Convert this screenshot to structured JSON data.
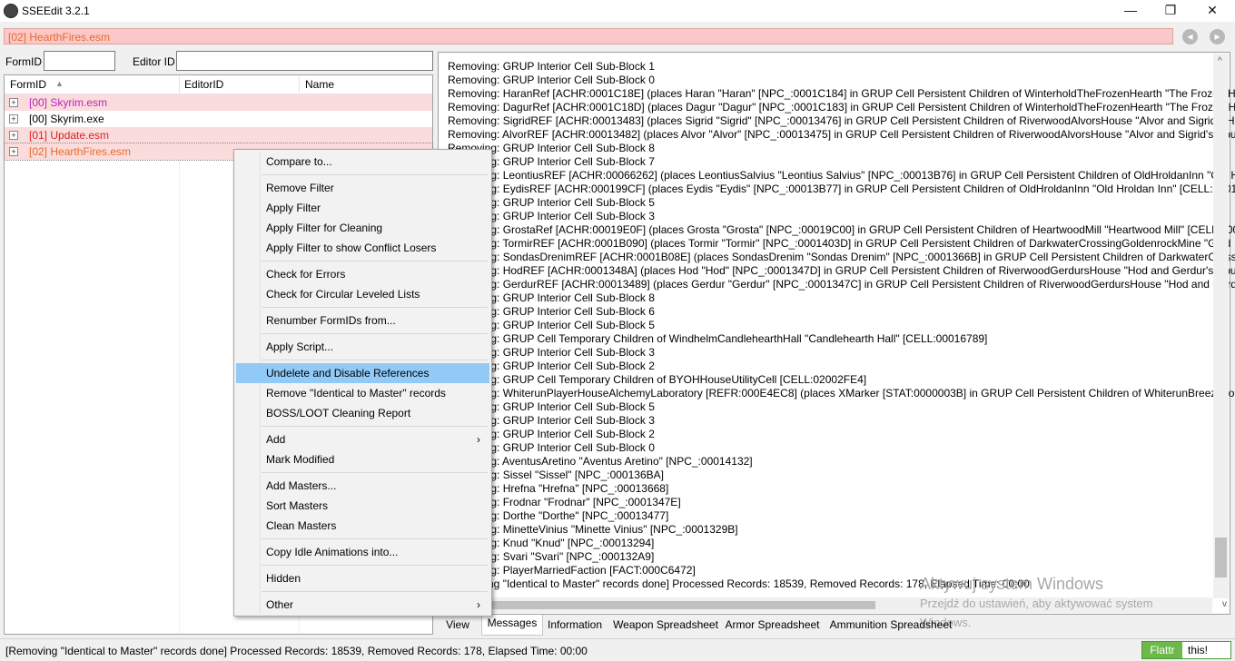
{
  "window": {
    "title": "SSEEdit 3.2.1",
    "minimize": "—",
    "maximize": "❐",
    "close": "✕"
  },
  "pathbar": {
    "text": "[02] HearthFires.esm",
    "back": "◂",
    "forward": "▸"
  },
  "filters": {
    "formid_label": "FormID",
    "editorid_label": "Editor ID",
    "formid_value": "",
    "editorid_value": ""
  },
  "tree": {
    "columns": [
      "FormID",
      "EditorID",
      "Name"
    ],
    "sort_arrow": "▲",
    "rows": [
      {
        "label": "[00] Skyrim.esm",
        "color": "#c020c0",
        "bg": "#fadcdc"
      },
      {
        "label": "[00] Skyrim.exe",
        "color": "#000000",
        "bg": "#ffffff"
      },
      {
        "label": "[01] Update.esm",
        "color": "#e02020",
        "bg": "#fadcdc"
      },
      {
        "label": "[02] HearthFires.esm",
        "color": "#e86a2a",
        "bg": "#fadcdc"
      }
    ]
  },
  "context_menu": {
    "items": [
      {
        "label": "Compare to...",
        "type": "item"
      },
      {
        "type": "sep"
      },
      {
        "label": "Remove Filter",
        "type": "item"
      },
      {
        "label": "Apply Filter",
        "type": "item"
      },
      {
        "label": "Apply Filter for Cleaning",
        "type": "item"
      },
      {
        "label": "Apply Filter to show Conflict Losers",
        "type": "item"
      },
      {
        "type": "sep"
      },
      {
        "label": "Check for Errors",
        "type": "item"
      },
      {
        "label": "Check for Circular Leveled Lists",
        "type": "item"
      },
      {
        "type": "sep"
      },
      {
        "label": "Renumber FormIDs from...",
        "type": "item"
      },
      {
        "type": "sep"
      },
      {
        "label": "Apply Script...",
        "type": "item"
      },
      {
        "type": "sep"
      },
      {
        "label": "Undelete and Disable References",
        "type": "item",
        "highlight": true
      },
      {
        "label": "Remove \"Identical to Master\" records",
        "type": "item"
      },
      {
        "label": "BOSS/LOOT Cleaning Report",
        "type": "item"
      },
      {
        "type": "sep"
      },
      {
        "label": "Add",
        "type": "item",
        "submenu": true
      },
      {
        "label": "Mark Modified",
        "type": "item"
      },
      {
        "type": "sep"
      },
      {
        "label": "Add Masters...",
        "type": "item"
      },
      {
        "label": "Sort Masters",
        "type": "item"
      },
      {
        "label": "Clean Masters",
        "type": "item"
      },
      {
        "type": "sep"
      },
      {
        "label": "Copy Idle Animations into...",
        "type": "item"
      },
      {
        "type": "sep"
      },
      {
        "label": "Hidden",
        "type": "item"
      },
      {
        "type": "sep"
      },
      {
        "label": "Other",
        "type": "item",
        "submenu": true
      }
    ],
    "submenu_arrow": "›"
  },
  "log": {
    "lines": [
      "Removing: GRUP Interior Cell Sub-Block 1",
      "Removing: GRUP Interior Cell Sub-Block 0",
      "Removing: HaranRef [ACHR:0001C18E] (places Haran \"Haran\" [NPC_:0001C184] in GRUP Cell Persistent Children of WinterholdTheFrozenHearth \"The Frozen H",
      "Removing: DagurRef [ACHR:0001C18D] (places Dagur \"Dagur\" [NPC_:0001C183] in GRUP Cell Persistent Children of WinterholdTheFrozenHearth \"The Frozen He",
      "Removing: SigridREF [ACHR:00013483] (places Sigrid \"Sigrid\" [NPC_:00013476] in GRUP Cell Persistent Children of RiverwoodAlvorsHouse \"Alvor and Sigrid's Ho",
      "Removing: AlvorREF [ACHR:00013482] (places Alvor \"Alvor\" [NPC_:00013475] in GRUP Cell Persistent Children of RiverwoodAlvorsHouse \"Alvor and Sigrid's Hous",
      "Removing: GRUP Interior Cell Sub-Block 8",
      "Removing: GRUP Interior Cell Sub-Block 7",
      "Removing: LeontiusREF [ACHR:00066262] (places LeontiusSalvius \"Leontius Salvius\" [NPC_:00013B76] in GRUP Cell Persistent Children of OldHroldanInn \"Old H",
      "Removing: EydisREF [ACHR:000199CF] (places Eydis \"Eydis\" [NPC_:00013B77] in GRUP Cell Persistent Children of OldHroldanInn \"Old Hroldan Inn\" [CELL:00013",
      "Removing: GRUP Interior Cell Sub-Block 5",
      "Removing: GRUP Interior Cell Sub-Block 3",
      "Removing: GrostaRef [ACHR:00019E0F] (places Grosta \"Grosta\" [NPC_:00019C00] in GRUP Cell Persistent Children of HeartwoodMill \"Heartwood Mill\" [CELL:000",
      "Removing: TormirREF [ACHR:0001B090] (places Tormir \"Tormir\" [NPC_:0001403D] in GRUP Cell Persistent Children of DarkwaterCrossingGoldenrockMine \"Gold",
      "Removing: SondasDrenimREF [ACHR:0001B08E] (places SondasDrenim \"Sondas Drenim\" [NPC_:0001366B] in GRUP Cell Persistent Children of DarkwaterCrossin",
      "Removing: HodREF [ACHR:0001348A] (places Hod \"Hod\" [NPC_:0001347D] in GRUP Cell Persistent Children of RiverwoodGerdursHouse \"Hod and Gerdur's Hou",
      "Removing: GerdurREF [ACHR:00013489] (places Gerdur \"Gerdur\" [NPC_:0001347C] in GRUP Cell Persistent Children of RiverwoodGerdursHouse \"Hod and Gerdu",
      "Removing: GRUP Interior Cell Sub-Block 8",
      "Removing: GRUP Interior Cell Sub-Block 6",
      "Removing: GRUP Interior Cell Sub-Block 5",
      "Removing: GRUP Cell Temporary Children of WindhelmCandlehearthHall \"Candlehearth Hall\" [CELL:00016789]",
      "Removing: GRUP Interior Cell Sub-Block 3",
      "Removing: GRUP Interior Cell Sub-Block 2",
      "Removing: GRUP Cell Temporary Children of BYOHHouseUtilityCell [CELL:02002FE4]",
      "Removing: WhiterunPlayerHouseAlchemyLaboratory [REFR:000E4EC8] (places XMarker [STAT:0000003B] in GRUP Cell Persistent Children of WhiterunBreezehor",
      "Removing: GRUP Interior Cell Sub-Block 5",
      "Removing: GRUP Interior Cell Sub-Block 3",
      "Removing: GRUP Interior Cell Sub-Block 2",
      "Removing: GRUP Interior Cell Sub-Block 0",
      "Removing: AventusAretino \"Aventus Aretino\" [NPC_:00014132]",
      "Removing: Sissel \"Sissel\" [NPC_:000136BA]",
      "Removing: Hrefna \"Hrefna\" [NPC_:00013668]",
      "Removing: Frodnar \"Frodnar\" [NPC_:0001347E]",
      "Removing: Dorthe \"Dorthe\" [NPC_:00013477]",
      "Removing: MinetteVinius \"Minette Vinius\" [NPC_:0001329B]",
      "Removing: Knud \"Knud\" [NPC_:00013294]",
      "Removing: Svari \"Svari\" [NPC_:000132A9]",
      "Removing: PlayerMarriedFaction [FACT:000C6472]",
      "[Removing \"Identical to Master\" records done]  Processed Records: 18539, Removed Records: 178, Elapsed Time: 00:00"
    ],
    "scroll_up": "^",
    "scroll_down": "v"
  },
  "tabs": [
    "View",
    "Messages",
    "Information",
    "Weapon Spreadsheet",
    "Armor Spreadsheet",
    "Ammunition Spreadsheet"
  ],
  "active_tab": "Messages",
  "status": {
    "text": "[Removing \"Identical to Master\" records done]  Processed Records: 18539, Removed Records: 178, Elapsed Time: 00:00"
  },
  "flattr": {
    "left": "Flattr",
    "right": "this!"
  },
  "watermark": {
    "line1": "Aktywuj system Windows",
    "line2": "Przejdź do ustawień, aby aktywować system",
    "line3": "Windows."
  }
}
